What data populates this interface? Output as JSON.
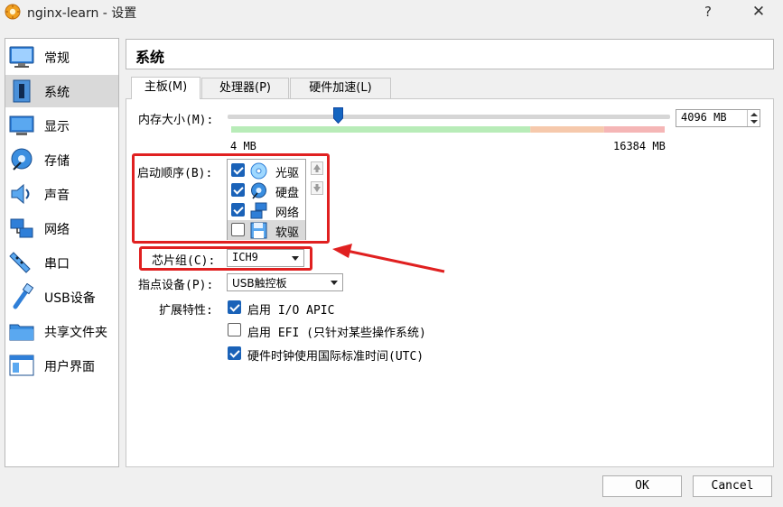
{
  "window": {
    "title": "nginx-learn - 设置",
    "help": "?",
    "close": "✕"
  },
  "sidebar": {
    "items": [
      {
        "label": "常规",
        "icon": "monitor-icon"
      },
      {
        "label": "系统",
        "icon": "motherboard-icon",
        "selected": true
      },
      {
        "label": "显示",
        "icon": "display-icon"
      },
      {
        "label": "存储",
        "icon": "storage-icon"
      },
      {
        "label": "声音",
        "icon": "speaker-icon"
      },
      {
        "label": "网络",
        "icon": "network-icon"
      },
      {
        "label": "串口",
        "icon": "serial-port-icon"
      },
      {
        "label": "USB设备",
        "icon": "usb-icon"
      },
      {
        "label": "共享文件夹",
        "icon": "folder-icon"
      },
      {
        "label": "用户界面",
        "icon": "user-interface-icon"
      }
    ]
  },
  "header": {
    "title": "系统"
  },
  "tabs": [
    {
      "label": "主板(M)",
      "active": true
    },
    {
      "label": "处理器(P)"
    },
    {
      "label": "硬件加速(L)"
    }
  ],
  "memory": {
    "label": "内存大小(M):",
    "value_text": "4096 MB",
    "min_label": "4 MB",
    "max_label": "16384 MB",
    "value_mb": 4096,
    "min_mb": 4,
    "max_mb": 16384
  },
  "boot_order": {
    "label": "启动顺序(B):",
    "items": [
      {
        "label": "光驱",
        "checked": true,
        "icon": "optical-disc-icon"
      },
      {
        "label": "硬盘",
        "checked": true,
        "icon": "hard-disk-icon"
      },
      {
        "label": "网络",
        "checked": true,
        "icon": "network-icon"
      },
      {
        "label": "软驱",
        "checked": false,
        "icon": "floppy-icon",
        "selected": true
      }
    ]
  },
  "chipset": {
    "label": "芯片组(C):",
    "value": "ICH9"
  },
  "pointing": {
    "label": "指点设备(P):",
    "value": "USB触控板"
  },
  "extended": {
    "label": "扩展特性:",
    "options": [
      {
        "label": "启用 I/O APIC",
        "checked": true
      },
      {
        "label": "启用 EFI (只针对某些操作系统)",
        "checked": false
      },
      {
        "label": "硬件时钟使用国际标准时间(UTC)",
        "checked": true
      }
    ]
  },
  "buttons": {
    "ok": "OK",
    "cancel": "Cancel"
  },
  "colors": {
    "annotation": "#e02020",
    "accent": "#1a62b8"
  }
}
